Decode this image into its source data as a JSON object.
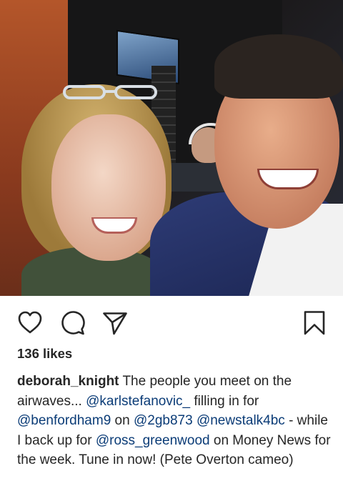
{
  "post": {
    "photo": {
      "description": "",
      "icon": "photo"
    },
    "actions": {
      "like_icon": "heart-icon",
      "comment_icon": "comment-icon",
      "share_icon": "send-icon",
      "save_icon": "bookmark-icon"
    },
    "likes": "136 likes",
    "caption": {
      "username": "deborah_knight",
      "segments": [
        {
          "type": "text",
          "value": " The people you meet on the airwaves... "
        },
        {
          "type": "mention",
          "value": "@karlstefanovic_"
        },
        {
          "type": "text",
          "value": " filling in for "
        },
        {
          "type": "mention",
          "value": "@benfordham9"
        },
        {
          "type": "text",
          "value": " on "
        },
        {
          "type": "mention",
          "value": "@2gb873"
        },
        {
          "type": "text",
          "value": " "
        },
        {
          "type": "mention",
          "value": "@newstalk4bc"
        },
        {
          "type": "text",
          "value": " - while I back up for "
        },
        {
          "type": "mention",
          "value": "@ross_greenwood"
        },
        {
          "type": "text",
          "value": " on Money News for the week. Tune in now! (Pete Overton cameo)"
        }
      ]
    }
  },
  "colors": {
    "text": "#262626",
    "mention": "#0b3c77",
    "background": "#ffffff"
  }
}
